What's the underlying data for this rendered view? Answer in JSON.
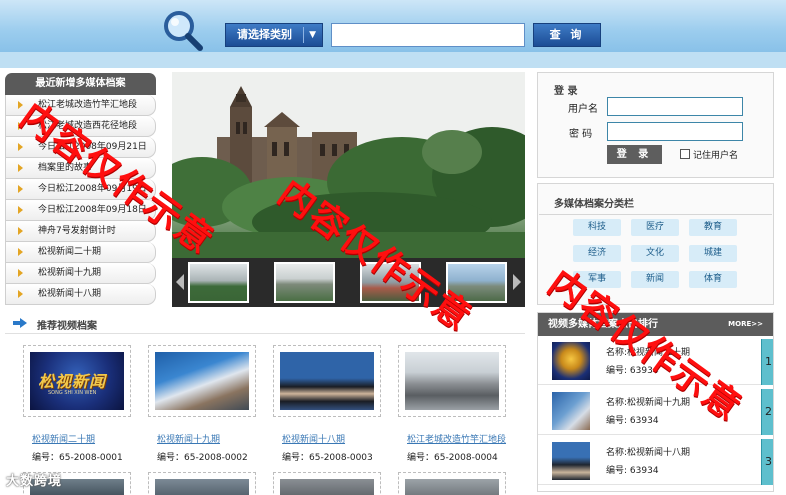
{
  "header": {
    "category_label": "请选择类别",
    "search_value": "",
    "query_label": "查 询"
  },
  "left_list": {
    "title": "最近新增多媒体档案",
    "items": [
      "松江老城改造竹竿汇地段",
      "松江老城改造西花径地段",
      "今日松江2008年09月21日",
      "档案里的故事",
      "今日松江2008年09月19日",
      "今日松江2008年09月18日",
      "神舟7号发射倒计时",
      "松视新闻二十期",
      "松视新闻十九期",
      "松视新闻十八期"
    ]
  },
  "login": {
    "title": "登 录",
    "username_label": "用户名",
    "password_label": "密  码",
    "button": "登 录",
    "remember_label": "记住用户名"
  },
  "categories": {
    "title": "多媒体档案分类栏",
    "items": [
      "科技",
      "医疗",
      "教育",
      "经济",
      "文化",
      "城建",
      "军事",
      "新闻",
      "体育"
    ]
  },
  "ranking": {
    "title": "视频多媒体档案点击排行",
    "more": "MORE>>",
    "name_prefix": "名称:",
    "no_prefix": "编号:",
    "items": [
      {
        "name": "松视新闻二十期",
        "no": "63934",
        "rank": "1"
      },
      {
        "name": "松视新闻十九期",
        "no": "63934",
        "rank": "2"
      },
      {
        "name": "松视新闻十八期",
        "no": "63934",
        "rank": "3"
      }
    ]
  },
  "recommended": {
    "title": "推荐视频档案",
    "items": [
      {
        "name": "松视新闻二十期",
        "no": "编号：65-2008-0001",
        "thumb_text": "松视新闻",
        "thumb_sub": "SONG SHI XIN WEN"
      },
      {
        "name": "松视新闻十九期",
        "no": "编号：65-2008-0002"
      },
      {
        "name": "松视新闻十八期",
        "no": "编号：65-2008-0003"
      },
      {
        "name": "松江老城改造竹竿汇地段",
        "no": "编号：65-2008-0004"
      }
    ]
  },
  "watermark": {
    "text": "内容仅作示意",
    "logo": "大数跨境"
  },
  "colors": {
    "header_blue": "#9ccdee",
    "button_blue": "#1b4c95",
    "dark_title": "#5a5a5a",
    "bullet_orange": "#e3a524",
    "category_bg": "#d7ecf8",
    "rank_tab": "#5ebfcd",
    "watermark_red": "#ff0f0f",
    "link_blue": "#3a78b5"
  }
}
